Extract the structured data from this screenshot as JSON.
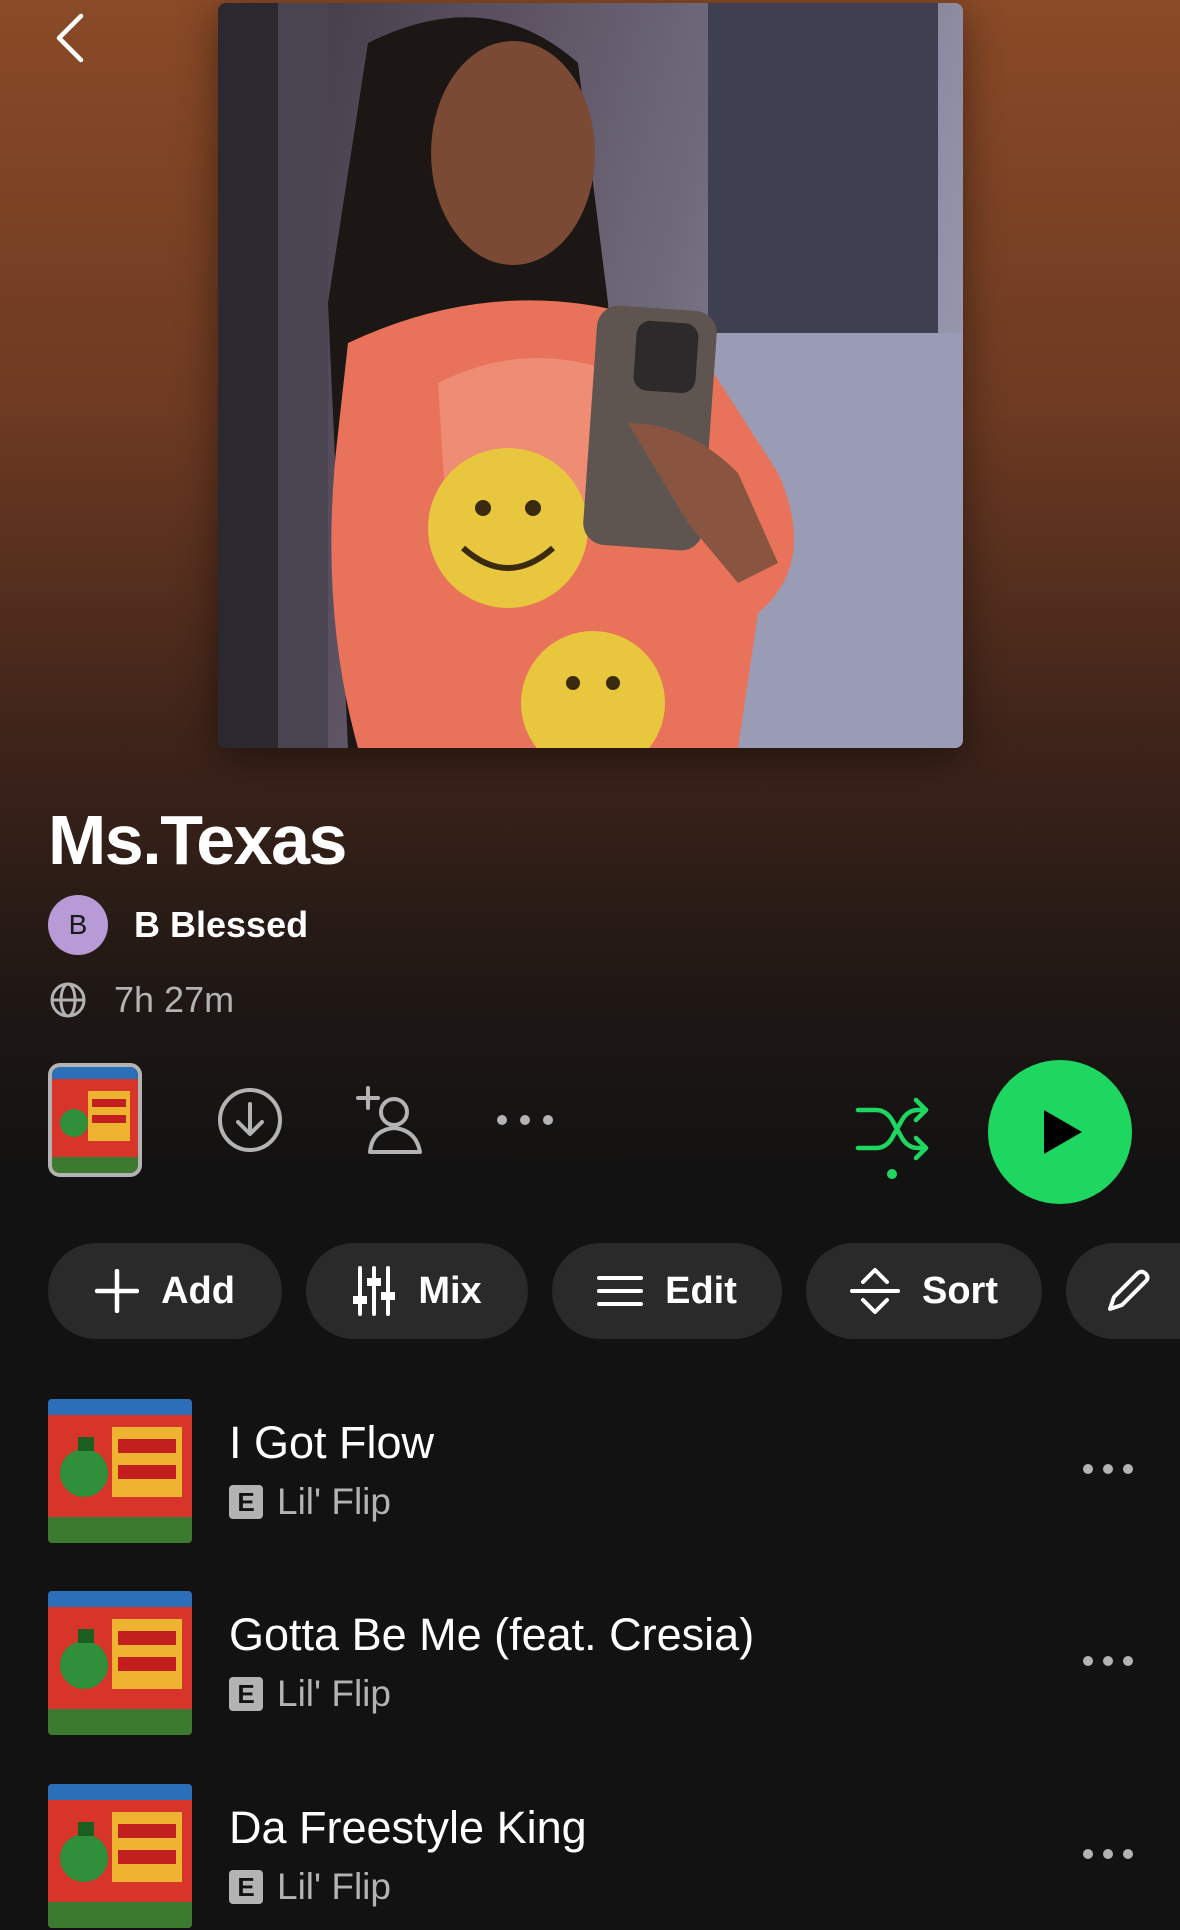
{
  "playlist": {
    "title": "Ms.Texas",
    "owner": {
      "initial": "B",
      "name": "B Blessed"
    },
    "duration": "7h 27m"
  },
  "colors": {
    "accent": "#1ed760",
    "header_gradient_top": "#8a4a27",
    "background": "#121212",
    "chip_background": "#2a2a2a",
    "avatar": "#b89ad6"
  },
  "icons": {
    "back": "chevron-left-icon",
    "visibility": "globe-icon",
    "download": "download-icon",
    "add_collaborator": "add-user-icon",
    "more": "more-horizontal-icon",
    "shuffle": "shuffle-icon",
    "play": "play-icon"
  },
  "chips": [
    {
      "label": "Add",
      "icon": "plus-icon"
    },
    {
      "label": "Mix",
      "icon": "sliders-icon"
    },
    {
      "label": "Edit",
      "icon": "list-icon"
    },
    {
      "label": "Sort",
      "icon": "sort-icon"
    },
    {
      "label": "",
      "icon": "pencil-icon"
    }
  ],
  "tracks": [
    {
      "title": "I Got Flow",
      "artist": "Lil' Flip",
      "explicit_label": "E"
    },
    {
      "title": "Gotta Be Me (feat. Cresia)",
      "artist": "Lil' Flip",
      "explicit_label": "E"
    },
    {
      "title": "Da Freestyle King",
      "artist": "Lil' Flip",
      "explicit_label": "E"
    }
  ]
}
